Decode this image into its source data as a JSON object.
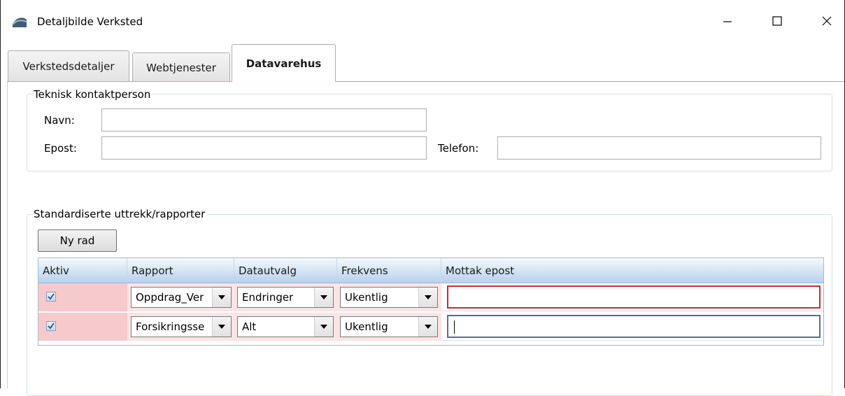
{
  "window": {
    "title": "Detaljbilde Verksted",
    "controls": [
      "minimize-icon",
      "maximize-icon",
      "close-icon"
    ]
  },
  "tabs": [
    {
      "label": "Verkstedsdetaljer",
      "selected": false
    },
    {
      "label": "Webtjenester",
      "selected": false
    },
    {
      "label": "Datavarehus",
      "selected": true
    }
  ],
  "contact": {
    "group_label": "Teknisk kontaktperson",
    "name_label": "Navn:",
    "name_value": "",
    "email_label": "Epost:",
    "email_value": "",
    "phone_label": "Telefon:",
    "phone_value": ""
  },
  "reports": {
    "group_label": "Standardiserte uttrekk/rapporter",
    "new_row_button": "Ny rad",
    "columns": [
      "Aktiv",
      "Rapport",
      "Datautvalg",
      "Frekvens",
      "Mottak epost"
    ],
    "rows": [
      {
        "aktiv": true,
        "rapport": "Oppdrag_Ver",
        "datautvalg": "Endringer",
        "frekvens": "Ukentlig",
        "mottak_epost": ""
      },
      {
        "aktiv": true,
        "rapport": "Forsikringsse",
        "datautvalg": "Alt",
        "frekvens": "Ukentlig",
        "mottak_epost": ""
      }
    ]
  },
  "colors": {
    "active_cell_bg": "#f6c9cc",
    "invalid_border": "#c32d3a",
    "header_gradient_end": "#b9d1ec"
  }
}
